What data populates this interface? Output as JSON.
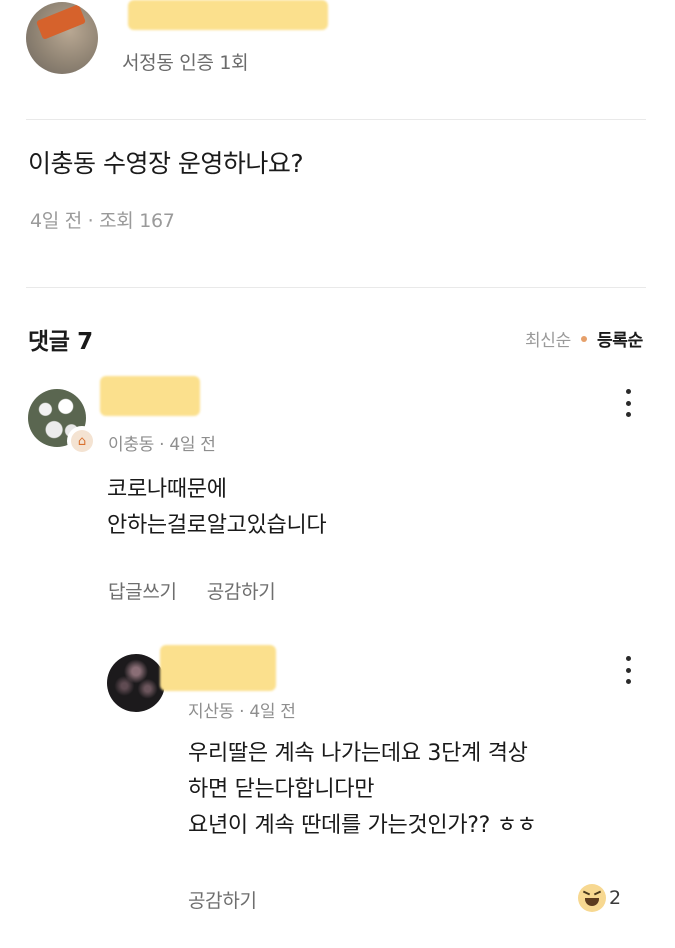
{
  "post": {
    "author_location": "서정동 인증 1회",
    "title": "이충동 수영장 운영하나요?",
    "meta": "4일 전 · 조회 167"
  },
  "comments_header": {
    "title": "댓글 7",
    "sort_latest": "최신순",
    "sort_registered": "등록순"
  },
  "comment": {
    "meta": "이충동 · 4일 전",
    "lines": [
      "코로나때문에",
      "안하는걸로알고있습니다"
    ],
    "reply_label": "답글쓰기",
    "like_label": "공감하기",
    "badge_icon": "home-badge-icon"
  },
  "reply": {
    "meta": "지산동 · 4일 전",
    "lines": [
      "우리딸은 계속 나가는데요 3단계 격상",
      "하면 닫는다합니다만",
      "요년이 계속 딴데를 가는것인가?? ㅎㅎ"
    ],
    "like_label": "공감하기",
    "reaction_icon": "laughing-emoji-icon",
    "reaction_count": "2"
  },
  "colors": {
    "highlight": "#fbe08d",
    "accent_dot": "#e6a06a",
    "muted_text": "#8e8e8e"
  }
}
